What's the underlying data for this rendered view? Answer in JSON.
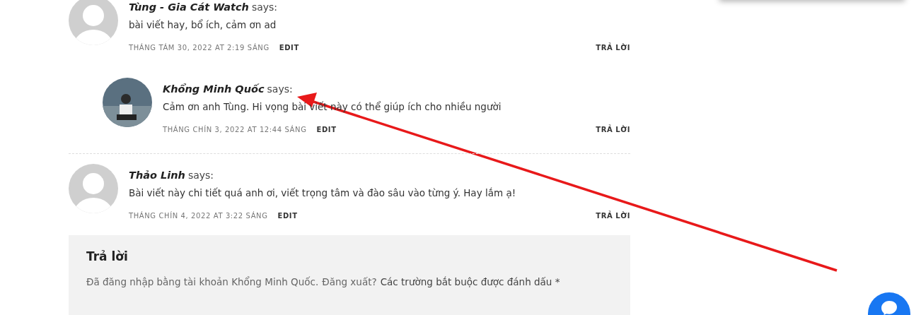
{
  "comments": [
    {
      "author": "Tùng - Gia Cát Watch",
      "says": "says:",
      "text": "bài viết hay, bổ ích, cảm ơn ad",
      "date": "THÁNG TÁM 30, 2022 AT 2:19 SÁNG",
      "edit": "EDIT",
      "reply": "TRẢ LỜI",
      "kind": "default",
      "children": [
        {
          "author": "Khổng Minh Quốc",
          "says": "says:",
          "text": "Cảm ơn anh Tùng. Hi vọng bài viết này có thể giúp ích cho nhiều người",
          "date": "THÁNG CHÍN 3, 2022 AT 12:44 SÁNG",
          "edit": "EDIT",
          "reply": "TRẢ LỜI",
          "kind": "photo"
        }
      ]
    },
    {
      "author": "Thảo Linh",
      "says": "says:",
      "text": "Bài viết này chi tiết quá anh ơi, viết trọng tâm và đào sâu vào từng ý. Hay lắm ạ!",
      "date": "THÁNG CHÍN 4, 2022 AT 3:22 SÁNG",
      "edit": "EDIT",
      "reply": "TRẢ LỜI",
      "kind": "default"
    }
  ],
  "reply_form": {
    "title": "Trả lời",
    "logged_in_text": "Đã đăng nhập bằng tài khoản Khổng Minh Quốc.",
    "logout_link": "Đăng xuất?",
    "required_note": "Các trường bắt buộc được đánh dấu *"
  }
}
